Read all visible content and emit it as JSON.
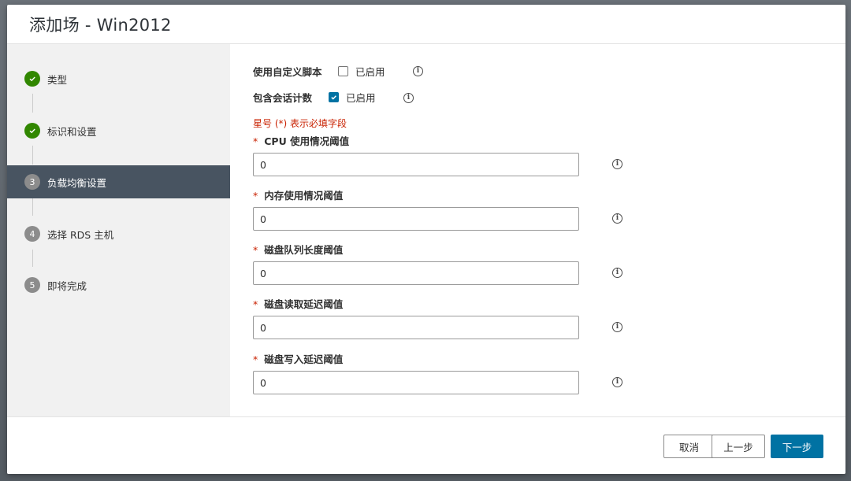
{
  "dialog": {
    "title": "添加场 - Win2012"
  },
  "wizard": {
    "steps": [
      {
        "number": "1",
        "label": "类型",
        "state": "done"
      },
      {
        "number": "2",
        "label": "标识和设置",
        "state": "done"
      },
      {
        "number": "3",
        "label": "负载均衡设置",
        "state": "current"
      },
      {
        "number": "4",
        "label": "选择 RDS 主机",
        "state": "pending"
      },
      {
        "number": "5",
        "label": "即将完成",
        "state": "pending"
      }
    ]
  },
  "options": {
    "custom_script": {
      "label": "使用自定义脚本",
      "checkbox_label": "已启用",
      "checked": false
    },
    "session_count": {
      "label": "包含会话计数",
      "checkbox_label": "已启用",
      "checked": true
    }
  },
  "required_note": "星号 (*) 表示必填字段",
  "fields": [
    {
      "label": "CPU 使用情况阈值",
      "value": "0"
    },
    {
      "label": "内存使用情况阈值",
      "value": "0"
    },
    {
      "label": "磁盘队列长度阈值",
      "value": "0"
    },
    {
      "label": "磁盘读取延迟阈值",
      "value": "0"
    },
    {
      "label": "磁盘写入延迟阈值",
      "value": "0"
    }
  ],
  "required_marker": "*",
  "info_glyph": "i",
  "footer": {
    "cancel_label": "取消",
    "back_label": "上一步",
    "next_label": "下一步"
  },
  "colors": {
    "primary": "#0072a3",
    "success": "#318700",
    "active_step_bg": "#485461",
    "required": "#c92100"
  }
}
